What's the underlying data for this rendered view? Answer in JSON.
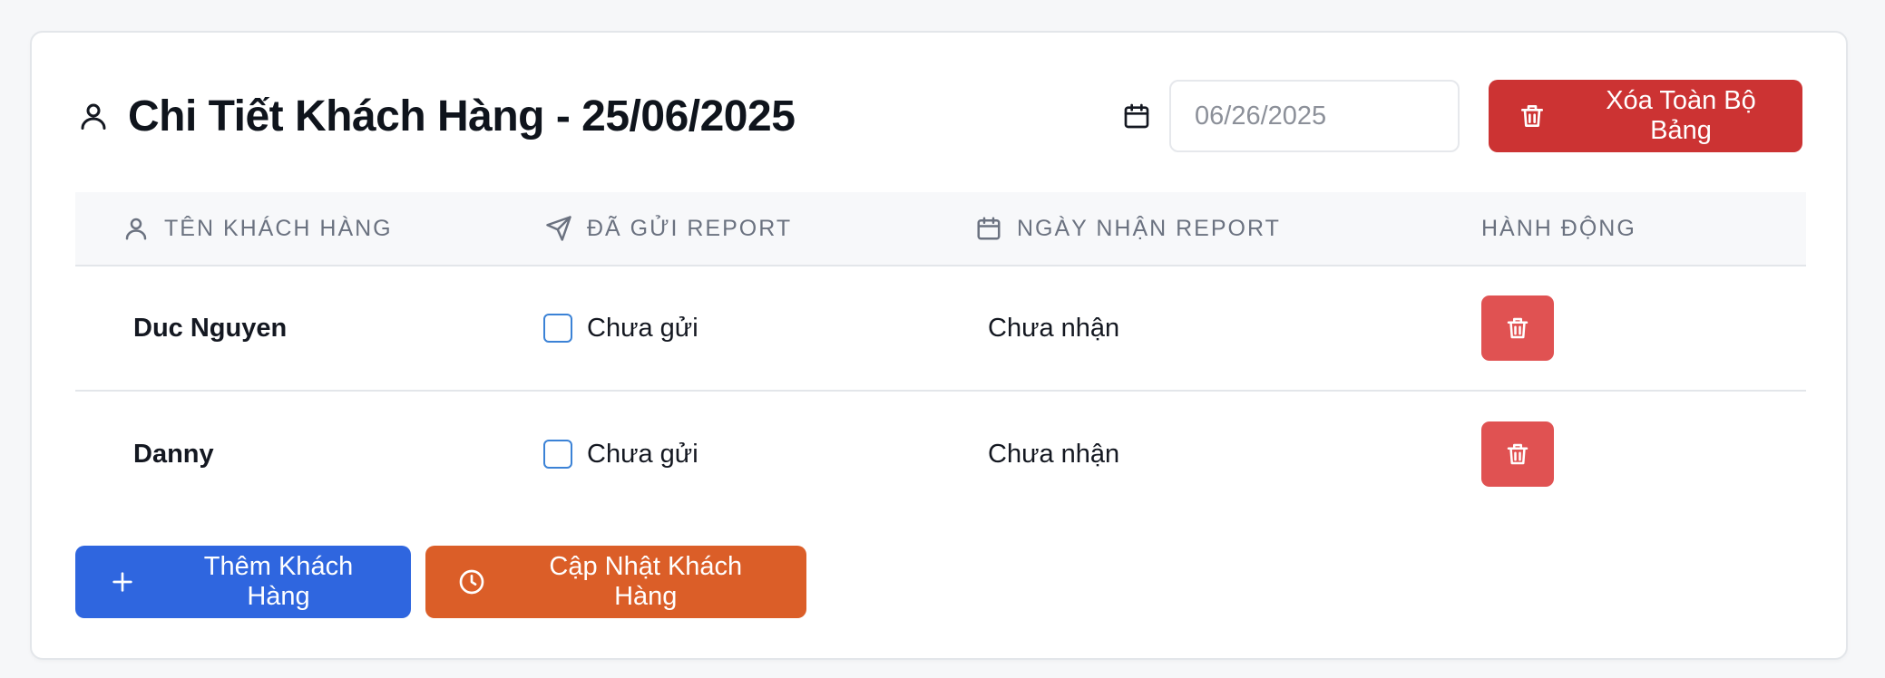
{
  "header": {
    "title": "Chi Tiết Khách Hàng - 25/06/2025",
    "title_icon": "user-icon",
    "date_icon": "calendar-icon",
    "date_value": "06/26/2025",
    "clear_all_label": "Xóa Toàn Bộ Bảng",
    "clear_all_icon": "trash-icon"
  },
  "table": {
    "columns": [
      {
        "label": "TÊN KHÁCH HÀNG",
        "icon": "user-icon"
      },
      {
        "label": "ĐÃ GỬI REPORT",
        "icon": "send-icon"
      },
      {
        "label": "NGÀY NHẬN REPORT",
        "icon": "calendar-icon"
      },
      {
        "label": "HÀNH ĐỘNG",
        "icon": ""
      }
    ],
    "rows": [
      {
        "name": "Duc Nguyen",
        "sent": false,
        "sent_label": "Chưa gửi",
        "received": "Chưa nhận"
      },
      {
        "name": "Danny",
        "sent": false,
        "sent_label": "Chưa gửi",
        "received": "Chưa nhận"
      }
    ]
  },
  "footer": {
    "add_label": "Thêm Khách Hàng",
    "add_icon": "plus-icon",
    "update_label": "Cập Nhật Khách Hàng",
    "update_icon": "clock-icon"
  },
  "colors": {
    "primary_blue": "#2f66df",
    "danger_red": "#cc3333",
    "row_delete_red": "#e05252",
    "update_orange": "#db5e28",
    "checkbox_border": "#3b82d6"
  }
}
